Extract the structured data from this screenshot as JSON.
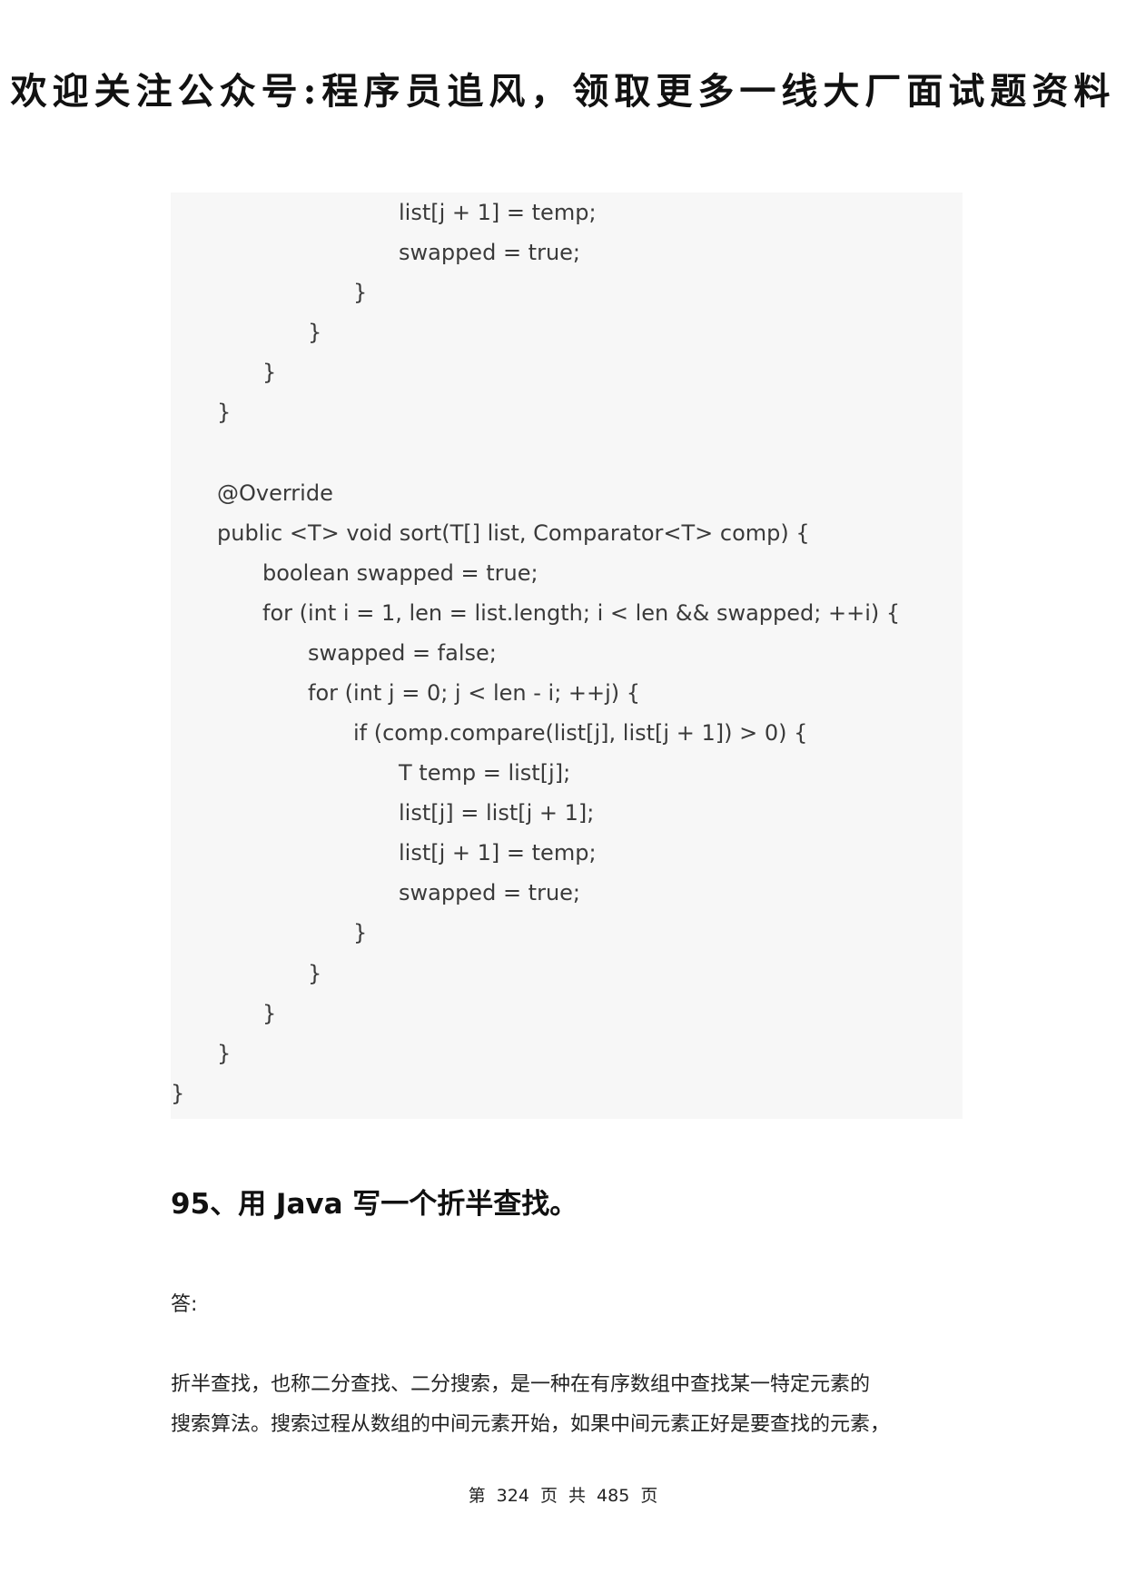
{
  "header": {
    "banner": "欢迎关注公众号:程序员追风，领取更多一线大厂面试题资料"
  },
  "code": {
    "lines": [
      "list[j + 1] = temp;",
      "swapped = true;",
      "}",
      "}",
      "}",
      "}",
      "@Override",
      "public <T> void sort(T[] list, Comparator<T> comp) {",
      "boolean swapped = true;",
      "for (int i = 1, len = list.length; i < len && swapped; ++i) {",
      "swapped = false;",
      "for (int j = 0; j < len - i; ++j) {",
      "if (comp.compare(list[j], list[j + 1]) > 0) {",
      "T temp = list[j];",
      "list[j] = list[j + 1];",
      "list[j + 1] = temp;",
      "swapped = true;",
      "}",
      "}",
      "}",
      "}",
      "}"
    ]
  },
  "section": {
    "heading": "95、用 Java 写一个折半查找。",
    "answer_label": "答:",
    "paragraph": [
      "折半查找，也称二分查找、二分搜索，是一种在有序数组中查找某一特定元素的",
      "搜索算法。搜索过程从数组的中间元素开始，如果中间元素正好是要查找的元素，"
    ]
  },
  "footer": {
    "page_label": "第 324 页 共 485 页"
  }
}
